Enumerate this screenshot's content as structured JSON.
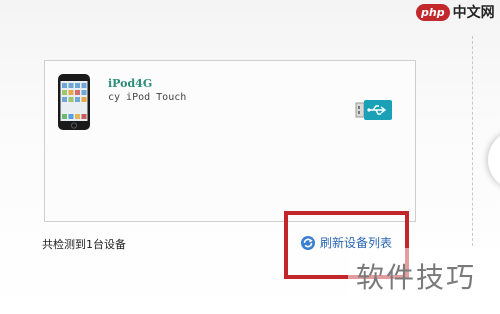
{
  "device": {
    "name": "iPod4G",
    "model": "cy iPod Touch",
    "icon": "ipod-touch-icon",
    "connection_icon": "usb-icon"
  },
  "status": {
    "detected_text": "共检测到1台设备"
  },
  "refresh": {
    "label": "刷新设备列表",
    "icon": "refresh-icon"
  },
  "branding": {
    "logo_prefix": "php",
    "logo_text": "中文网",
    "watermark": "软件技巧"
  },
  "colors": {
    "highlight": "#c3262a",
    "link": "#2b67b4",
    "device_name": "#2c8c7a"
  }
}
